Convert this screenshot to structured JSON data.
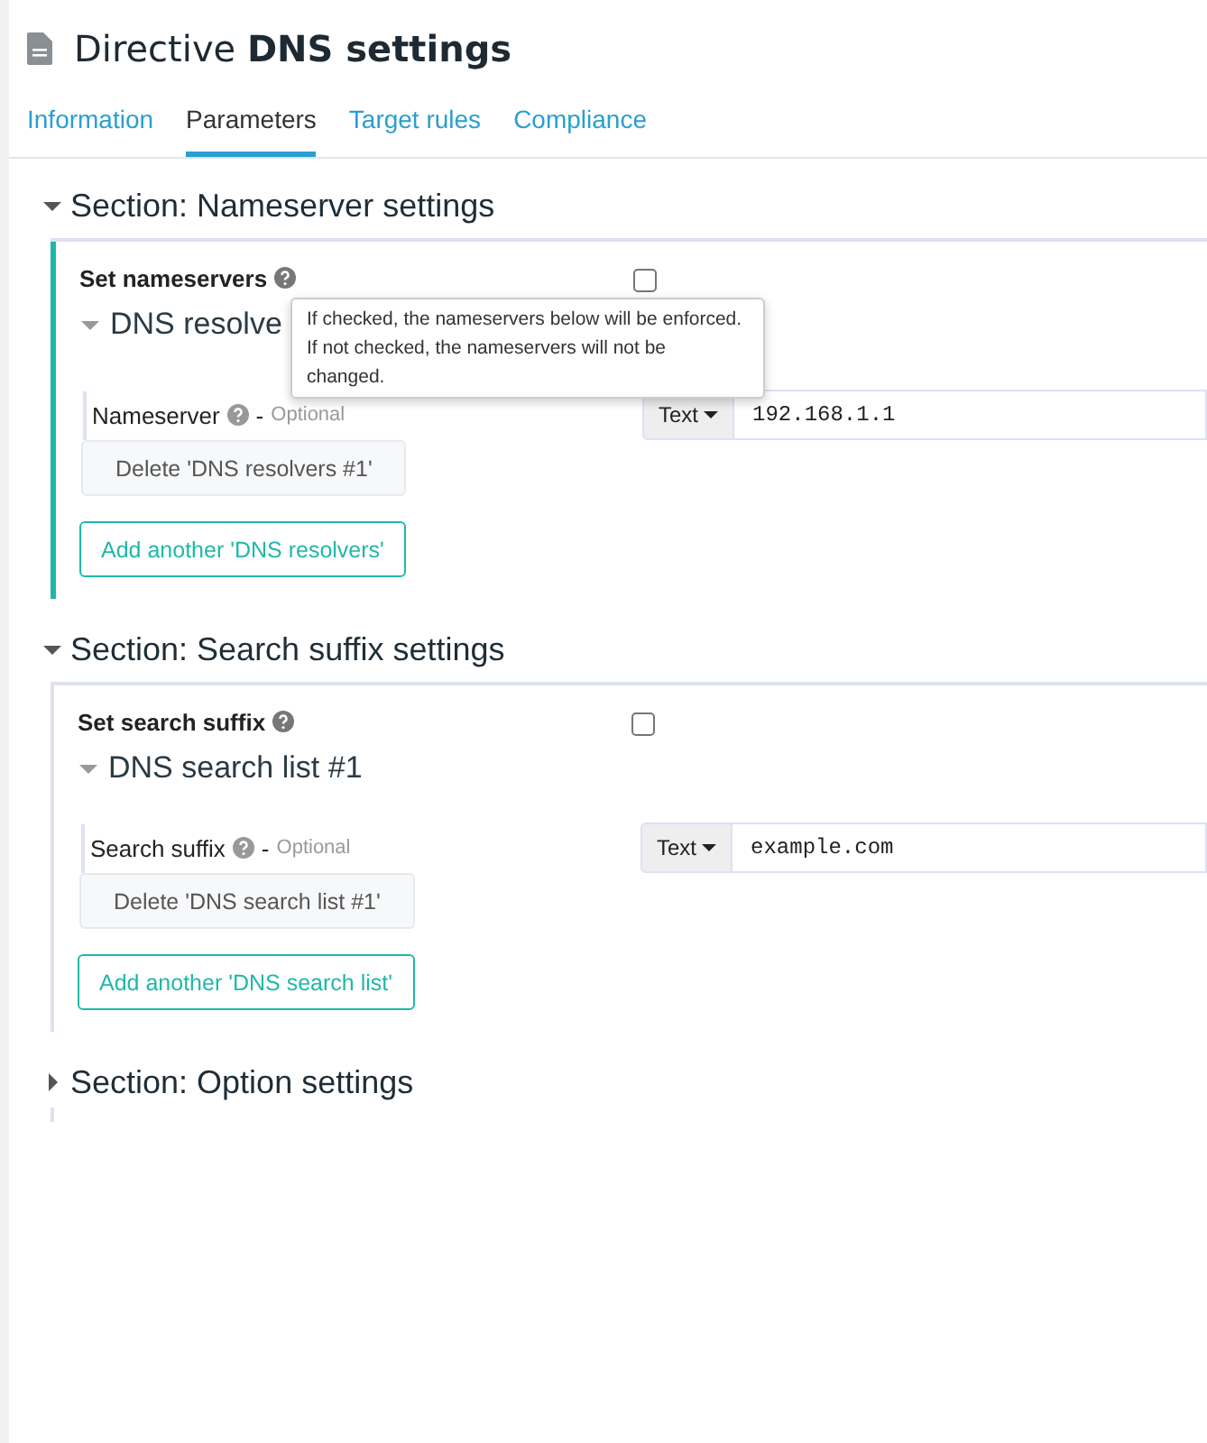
{
  "title": "Directive **DNS settings**",
  "tabs": [
    {
      "label": "Information",
      "selected": false
    },
    {
      "label": "Parameters",
      "selected": true
    },
    {
      "label": "Target rules",
      "selected": false
    },
    {
      "label": "Compliance",
      "selected": false
    }
  ],
  "sections": [
    {
      "title": "Section: Nameserver settings",
      "expanded": true,
      "active": true,
      "checkbox": {
        "label": "Set nameservers",
        "checked": false
      },
      "tooltip": "If checked, the nameservers below will be enforced. If not checked, the nameservers will not be changed.",
      "group": {
        "title": "DNS resolve",
        "expanded": true,
        "param": {
          "label": "Nameserver",
          "separator": "-",
          "hint": "Optional",
          "type": "Text",
          "value": "192.168.1.1"
        },
        "delete": "Delete 'DNS resolvers #1'"
      },
      "add": "Add another 'DNS resolvers'"
    },
    {
      "title": "Section: Search suffix settings",
      "expanded": true,
      "active": false,
      "checkbox": {
        "label": "Set search suffix",
        "checked": false
      },
      "group": {
        "title": "DNS search list #1",
        "expanded": true,
        "param": {
          "label": "Search suffix",
          "separator": "-",
          "hint": "Optional",
          "type": "Text",
          "value": "example.com"
        },
        "delete": "Delete 'DNS search list #1'"
      },
      "add": "Add another 'DNS search list'"
    },
    {
      "title": "Section: Option settings",
      "expanded": false,
      "active": false
    }
  ]
}
